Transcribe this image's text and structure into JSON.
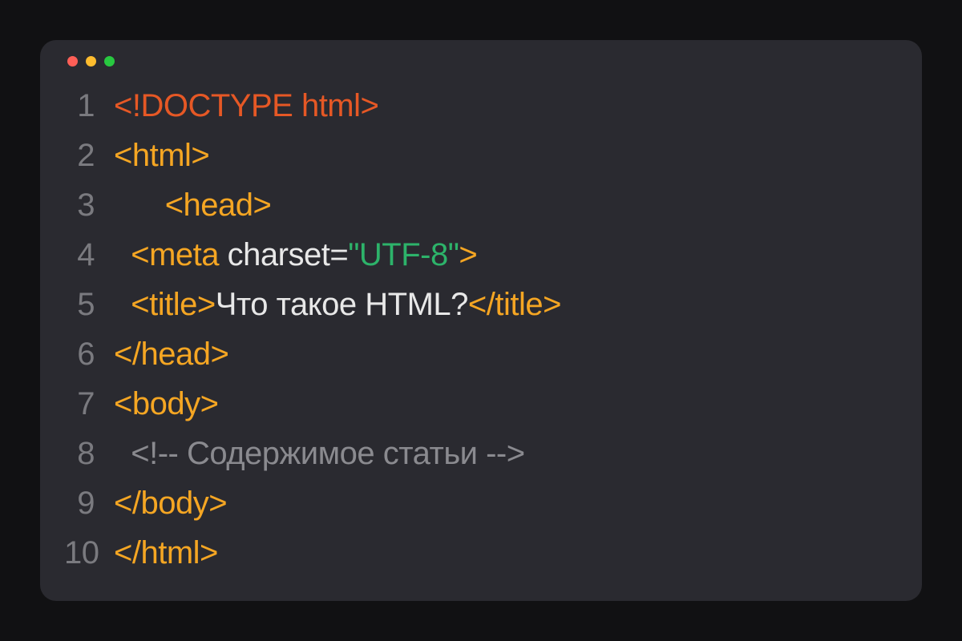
{
  "lines": [
    {
      "n": "1",
      "segments": [
        {
          "t": "<!DOCTYPE html>",
          "c": "c-doctype"
        }
      ]
    },
    {
      "n": "2",
      "segments": [
        {
          "t": "<html>",
          "c": "c-tag"
        }
      ]
    },
    {
      "n": "3",
      "segments": [
        {
          "t": "      ",
          "c": "c-tag"
        },
        {
          "t": "<head>",
          "c": "c-tag"
        }
      ]
    },
    {
      "n": "4",
      "segments": [
        {
          "t": "  ",
          "c": "c-tag"
        },
        {
          "t": "<meta",
          "c": "c-tag"
        },
        {
          "t": " charset=",
          "c": "c-attr"
        },
        {
          "t": "\"UTF-8\"",
          "c": "c-str"
        },
        {
          "t": ">",
          "c": "c-tag"
        }
      ]
    },
    {
      "n": "5",
      "segments": [
        {
          "t": "  ",
          "c": "c-tag"
        },
        {
          "t": "<title>",
          "c": "c-tag"
        },
        {
          "t": "Что такое HTML?",
          "c": "c-text"
        },
        {
          "t": "</title>",
          "c": "c-tag"
        }
      ]
    },
    {
      "n": "6",
      "segments": [
        {
          "t": "</head>",
          "c": "c-tag"
        }
      ]
    },
    {
      "n": "7",
      "segments": [
        {
          "t": "<body>",
          "c": "c-tag"
        }
      ]
    },
    {
      "n": "8",
      "segments": [
        {
          "t": "  ",
          "c": "c-comment"
        },
        {
          "t": "<!-- Содержимое статьи -->",
          "c": "c-comment"
        }
      ]
    },
    {
      "n": "9",
      "segments": [
        {
          "t": "</body>",
          "c": "c-tag"
        }
      ]
    },
    {
      "n": "10",
      "segments": [
        {
          "t": "</html>",
          "c": "c-tag"
        }
      ]
    }
  ]
}
